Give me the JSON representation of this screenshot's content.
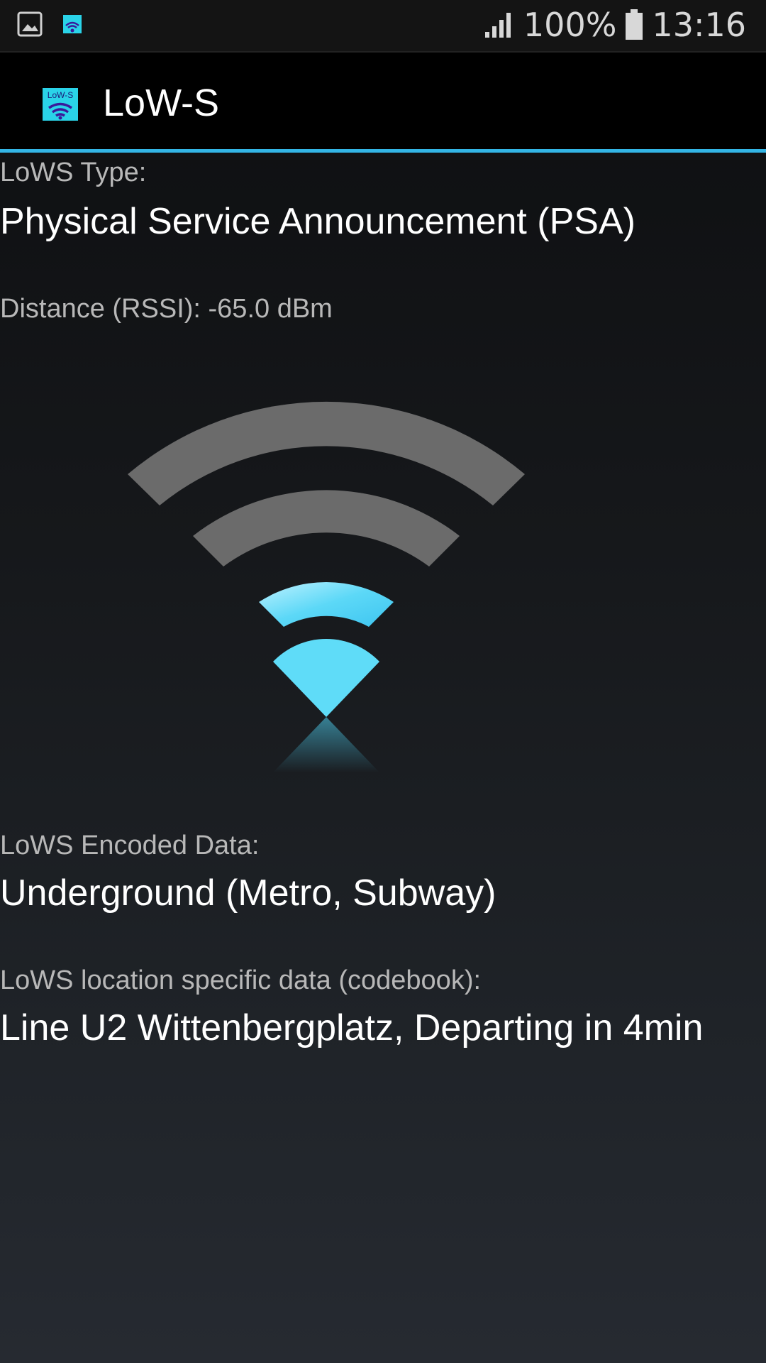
{
  "status_bar": {
    "battery_percent": "100%",
    "time": "13:16",
    "left_icons": [
      "gallery-notification-icon",
      "lows-notification-icon"
    ],
    "right_icons": [
      "signal-icon",
      "battery-icon"
    ]
  },
  "app_bar": {
    "title": "LoW-S",
    "logo_text": "LoW-S",
    "accent_color": "#33b5e5"
  },
  "fields": {
    "type_label": "LoWS Type:",
    "type_value": "Physical Service Announcement (PSA)",
    "distance_text": "Distance (RSSI): -65.0 dBm",
    "encoded_label": "LoWS Encoded Data:",
    "encoded_value": "Underground (Metro, Subway)",
    "location_label": "LoWS location specific data (codebook):",
    "location_value": "Line U2 Wittenbergplatz, Departing in 4min"
  },
  "signal": {
    "bars_total": 4,
    "bars_active": 2,
    "active_color": "#4fd3f5",
    "inactive_color": "#6b6b6b"
  }
}
